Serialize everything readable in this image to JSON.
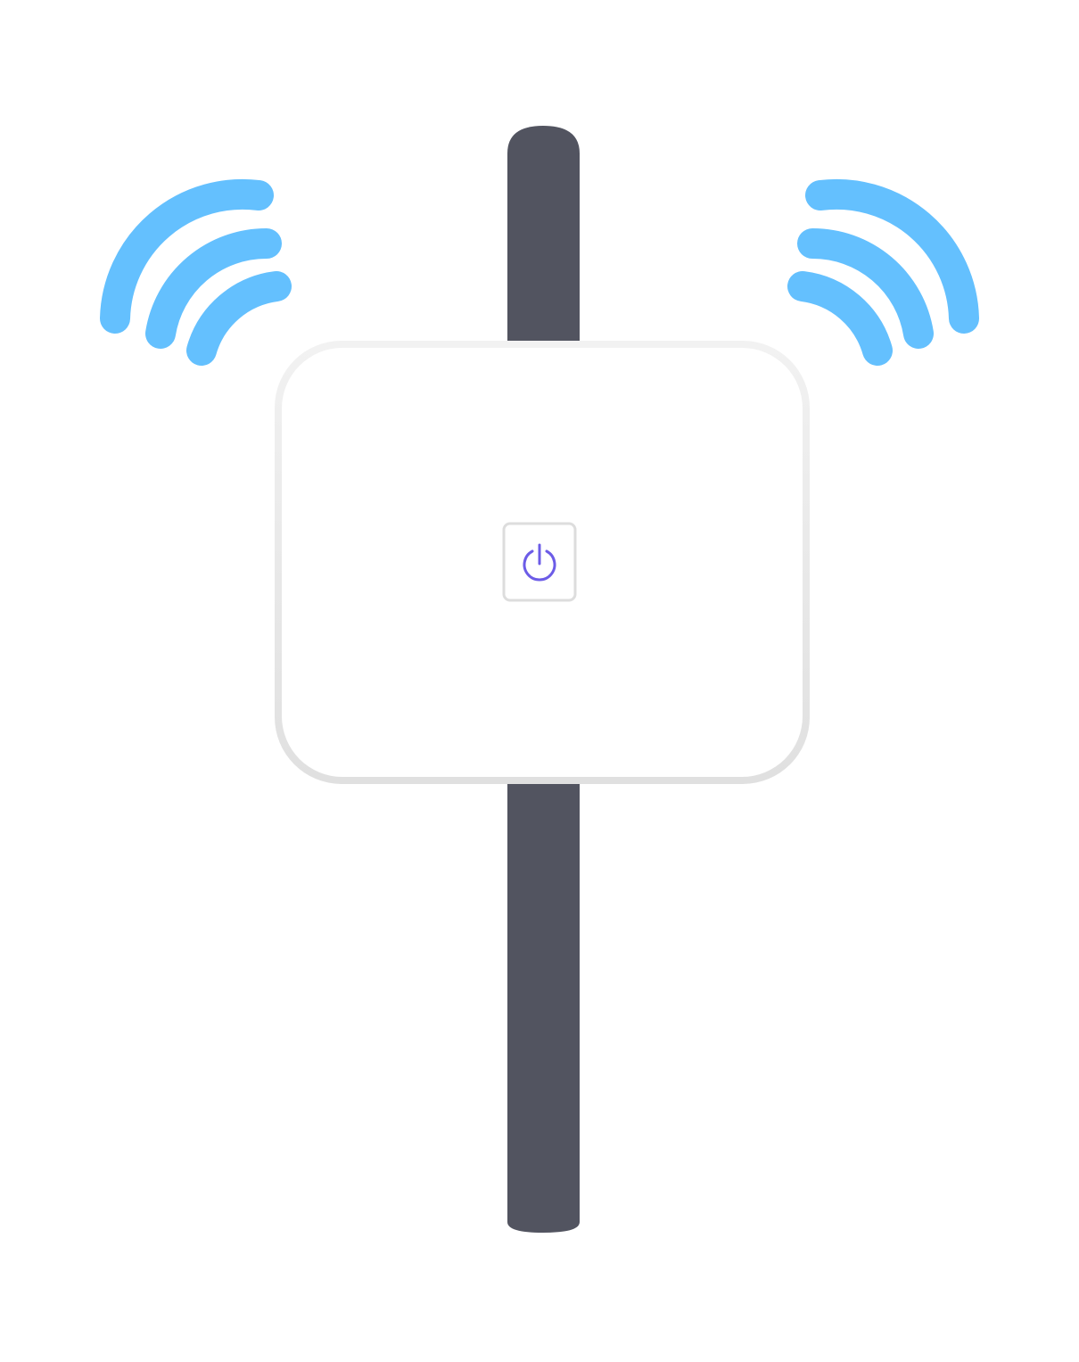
{
  "illustration": {
    "subject": "wireless-access-point",
    "colors": {
      "background": "#ffffff",
      "pole": "#525460",
      "device_body": "#ffffff",
      "device_rim_top": "#f2f2f2",
      "device_rim_bottom": "#e0e0e0",
      "signal": "#64c0fe",
      "power_button_border": "#dddddd",
      "power_icon": "#6c5ce7"
    },
    "icons": {
      "power": "power-icon",
      "signal_left": "wifi-signal-left-icon",
      "signal_right": "wifi-signal-right-icon"
    },
    "signal_arc_count": 3
  }
}
